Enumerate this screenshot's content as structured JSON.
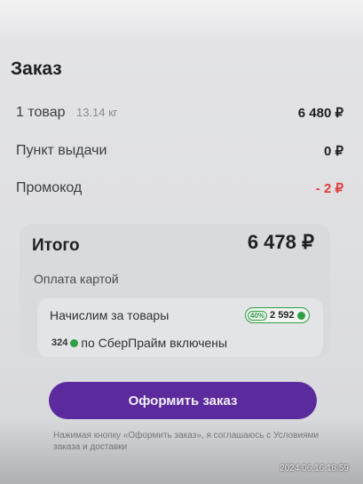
{
  "order": {
    "title": "Заказ",
    "rows": [
      {
        "label": "1 товар",
        "weight": "13.14 кг",
        "value": "6 480 ₽"
      },
      {
        "label": "Пункт выдачи",
        "value": "0 ₽"
      },
      {
        "label": "Промокод",
        "value": "- 2 ₽"
      }
    ],
    "total_label": "Итого",
    "total_value": "6 478 ₽",
    "payment_method": "Оплата картой",
    "bonus": {
      "accrual_label": "Начислим за товары",
      "percent": "40%",
      "points": "2 592",
      "prime_points": "324",
      "prime_text": "по СберПрайм включены"
    },
    "submit_label": "Оформить заказ",
    "terms": "Нажимая кнопку «Оформить заказ», я соглашаюсь с Условиями заказа и доставки"
  },
  "photo_timestamp": "2024.06.16 18:59",
  "colors": {
    "accent": "#5b2a9c",
    "bonus_green": "#2f9e44",
    "discount_red": "#e23b3b"
  }
}
